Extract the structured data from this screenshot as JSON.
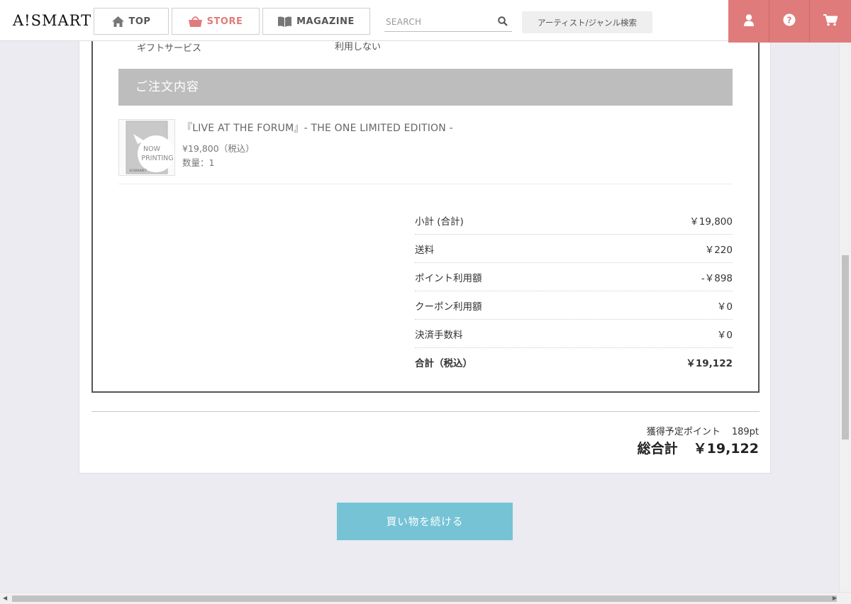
{
  "header": {
    "logo": "A!SMART",
    "nav": {
      "top": "TOP",
      "store": "STORE",
      "magazine": "MAGAZINE"
    },
    "search": {
      "placeholder": "SEARCH"
    },
    "artist_search": "アーティスト/ジャンル検索",
    "icons": [
      "user-icon",
      "help-icon",
      "cart-icon"
    ]
  },
  "order": {
    "gift": {
      "label": "ギフトサービス",
      "value": "利用しない"
    },
    "section_title": "ご注文内容",
    "item": {
      "thumb_text_1": "NOW",
      "thumb_text_2": "PRINTING",
      "thumb_brand": "A!SMART",
      "title": "『LIVE AT THE FORUM』- THE ONE LIMITED EDITION -",
      "price": "¥19,800（税込）",
      "quantity": "数量：1"
    },
    "summary": [
      {
        "label": "小計 (合計)",
        "value": "￥19,800"
      },
      {
        "label": "送料",
        "value": "￥220"
      },
      {
        "label": "ポイント利用額",
        "value": "-￥898"
      },
      {
        "label": "クーポン利用額",
        "value": "￥0"
      },
      {
        "label": "決済手数料",
        "value": "￥0"
      },
      {
        "label": "合計（税込）",
        "value": "￥19,122"
      }
    ]
  },
  "totals": {
    "points_label": "獲得予定ポイント",
    "points_value": "189pt",
    "grand_label": "総合計",
    "grand_value": "￥19,122"
  },
  "continue_button": "買い物を続ける",
  "colors": {
    "accent": "#e07b7b",
    "button": "#76c3d6",
    "section_bar": "#bdbdbd",
    "page_bg": "#ebebf1"
  }
}
